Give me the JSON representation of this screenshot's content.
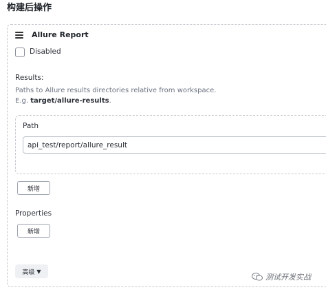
{
  "section_title": "构建后操作",
  "step": {
    "title": "Allure Report",
    "disabled_label": "Disabled"
  },
  "results": {
    "label": "Results:",
    "help_line1": "Paths to Allure results directories relative from workspace.",
    "help_prefix": "E.g. ",
    "help_example": "target/allure-results",
    "help_suffix": ".",
    "path_label": "Path",
    "path_value": "api_test/report/allure_result",
    "add_button": "新增"
  },
  "properties": {
    "label": "Properties",
    "add_button": "新增"
  },
  "advanced": {
    "label": "高级"
  },
  "watermark": {
    "text": "测试开发实战"
  }
}
